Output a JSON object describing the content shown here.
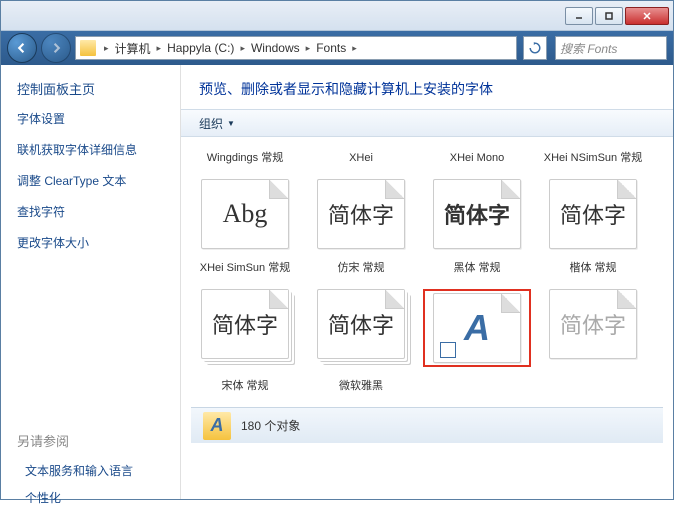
{
  "titlebar": {},
  "nav": {
    "breadcrumb": [
      "计算机",
      "Happyla (C:)",
      "Windows",
      "Fonts"
    ],
    "search_placeholder": "搜索 Fonts"
  },
  "sidebar": {
    "title": "控制面板主页",
    "links": [
      "字体设置",
      "联机获取字体详细信息",
      "调整 ClearType 文本",
      "查找字符",
      "更改字体大小"
    ],
    "see_also_title": "另请参阅",
    "see_also": [
      "文本服务和输入语言",
      "个性化"
    ]
  },
  "content": {
    "header": "预览、删除或者显示和隐藏计算机上安装的字体",
    "toolbar_organize": "组织"
  },
  "fonts": {
    "row1": [
      {
        "label": "Wingdings 常规",
        "sample": "",
        "thumb": false
      },
      {
        "label": "XHei",
        "sample": "",
        "thumb": false
      },
      {
        "label": "XHei Mono",
        "sample": "",
        "thumb": false
      },
      {
        "label": "XHei NSimSun 常规",
        "sample": "",
        "thumb": false
      }
    ],
    "row2": [
      {
        "label": "XHei SimSun 常规",
        "sample": "Abg"
      },
      {
        "label": "仿宋 常规",
        "sample": "简体字"
      },
      {
        "label": "黑体 常规",
        "sample": "简体字"
      },
      {
        "label": "楷体 常规",
        "sample": "简体字"
      }
    ],
    "row3": [
      {
        "label": "宋体 常规",
        "sample": "简体字",
        "stack": true
      },
      {
        "label": "微软雅黑",
        "sample": "简体字",
        "stack": true
      },
      {
        "label": "",
        "sample": "A",
        "shortcut": true,
        "highlight": true
      },
      {
        "label": "",
        "sample": "简体字",
        "faded": true
      }
    ]
  },
  "status": {
    "count_text": "180 个对象"
  }
}
